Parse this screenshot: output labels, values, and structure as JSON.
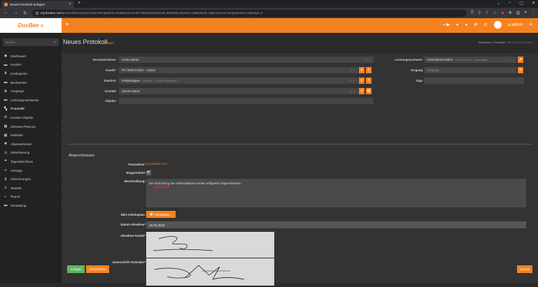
{
  "browser": {
    "tab_title": "Neues Protokoll anlegen",
    "url_domain": "my.docbee.com",
    "url_path": "/protocolDocument/create?templateId=2449&customerId=96012&locationId=80695&contactId=18&ticketId=18&customerComponentId=18&page=2"
  },
  "header": {
    "logo_text": "DocBee",
    "logo_mark": "»",
    "username": "a.admin"
  },
  "sidebar": {
    "search_placeholder": "Suche...",
    "items": [
      {
        "icon": "dashboard-icon",
        "glyph": "◉",
        "label": "Dashboard",
        "chevron": ""
      },
      {
        "icon": "customers-icon",
        "glyph": "▬",
        "label": "Kunden",
        "chevron": "‹"
      },
      {
        "icon": "quota-icon",
        "glyph": "⧗",
        "label": "Kontingente",
        "chevron": ""
      },
      {
        "icon": "observer-icon",
        "glyph": "▬",
        "label": "Beobachter",
        "chevron": ""
      },
      {
        "icon": "tasks-icon",
        "glyph": "✥",
        "label": "Vorgänge",
        "chevron": "‹"
      },
      {
        "icon": "proof-icon",
        "glyph": "▬",
        "label": "Leistungsnachweise",
        "chevron": "‹"
      },
      {
        "icon": "protocol-icon",
        "glyph": "▚",
        "label": "Protokolle",
        "chevron": ""
      },
      {
        "icon": "customer-objects-icon",
        "glyph": "⚙",
        "label": "Kunden-Objekte",
        "chevron": ""
      },
      {
        "icon": "period-planning-icon",
        "glyph": "▦",
        "label": "Zeitraum-Planung",
        "chevron": "‹"
      },
      {
        "icon": "calendar-icon",
        "glyph": "▦",
        "label": "Kalender",
        "chevron": "‹"
      },
      {
        "icon": "absences-icon",
        "glyph": "✖",
        "label": "Abwesenheiten",
        "chevron": "‹"
      },
      {
        "icon": "time-tracking-icon",
        "glyph": "◷",
        "label": "Zeiterfassung",
        "chevron": "‹"
      },
      {
        "icon": "daily-reports-icon",
        "glyph": "☂",
        "label": "Tagesabschluss",
        "chevron": "‹"
      },
      {
        "icon": "contracts-icon",
        "glyph": "∞",
        "label": "Verträge",
        "chevron": "‹"
      },
      {
        "icon": "billing-icon",
        "glyph": "$",
        "label": "Abrechnungen",
        "chevron": ""
      },
      {
        "icon": "statistics-icon",
        "glyph": "∠",
        "label": "Statistik",
        "chevron": "‹"
      },
      {
        "icon": "report-icon",
        "glyph": "◐",
        "label": "Report",
        "chevron": ""
      },
      {
        "icon": "admin-icon",
        "glyph": "▬",
        "label": "Verwaltung",
        "chevron": "‹"
      }
    ]
  },
  "page": {
    "title": "Neues Protokoll",
    "subtitle": "anlegen",
    "breadcrumb": [
      "Dashboard",
      "Protokolle",
      "Neues Protokoll anle..."
    ]
  },
  "form": {
    "responsible": {
      "label": "Verantwortlicher",
      "value": "Anka Admin"
    },
    "customer": {
      "label": "Kunde*",
      "value": "PC Welt GmbH - 10001"
    },
    "location": {
      "label": "Standort",
      "value": "Hadanhagen",
      "hint": "Langestr. 2, 10780 Hadanhagen"
    },
    "contact": {
      "label": "Kontakt",
      "value": "James Band"
    },
    "objects": {
      "label": "Objekte",
      "value": ""
    },
    "proof": {
      "label": "Leistungsnachweis",
      "value": "#28230616-00001",
      "hint": "PC Welt GmbH - Hadanhagen"
    },
    "task": {
      "label": "Vorgang",
      "placeholder": "Vorgang"
    },
    "tags": {
      "label": "Tags",
      "value": ""
    }
  },
  "completed": {
    "title": "Abgeschlossen",
    "password_label": "Passwörter:",
    "password_value": "my.docbee.com",
    "installed_label": "Eingerichtet?",
    "installed_checked": "✔",
    "description_label": "Beschreibung:",
    "description_prefix": "Die ",
    "description_misspelled": "Einrichtung",
    "description_suffix": " des Arbeitsplatzes wurden erfolgreich abgeschlossen.",
    "image_label": "Bild Arbeitsplatz:",
    "upload_label": "Hochladen...",
    "date_label": "Datum Abnahme*",
    "date_value": "16.06.2023",
    "customer_sign_label": "Abnahme Kunde*",
    "tech_sign_label": "Unterschrift Techniker*"
  },
  "buttons": {
    "create": "Anlegen",
    "complete": "Abschließen",
    "back": "Zurück"
  },
  "colors": {
    "accent": "#f58220",
    "success": "#5cb85c"
  }
}
